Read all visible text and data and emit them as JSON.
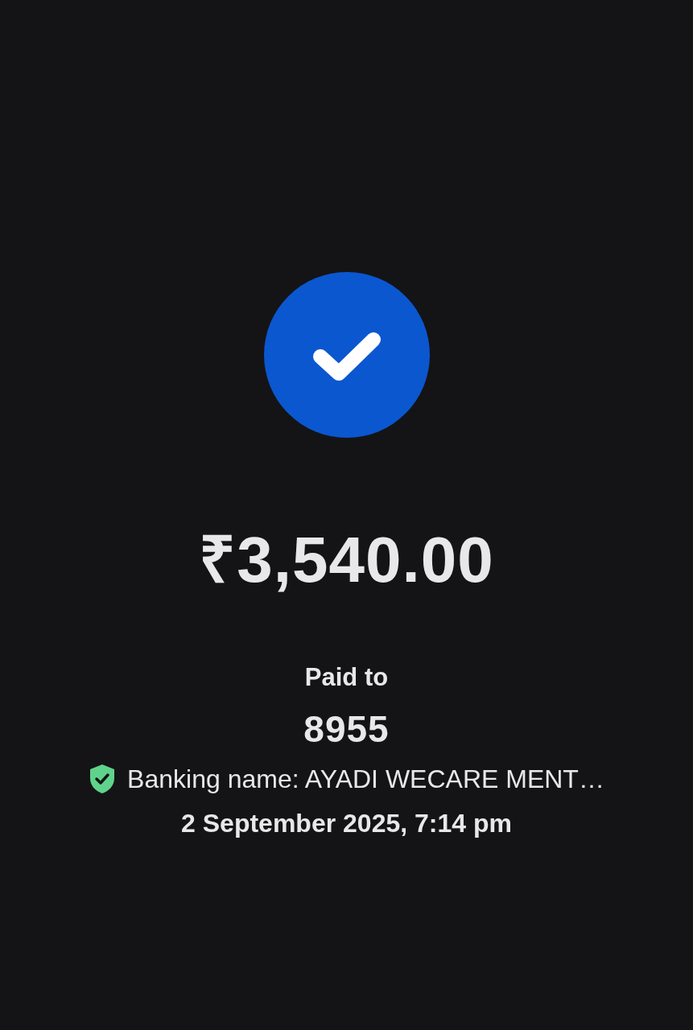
{
  "amount": "₹3,540.00",
  "paid_label": "Paid to",
  "payee": "8955",
  "banking_name": {
    "verified": true,
    "text": "Banking name: AYADI WECARE MENT…"
  },
  "datetime": "2 September 2025, 7:14 pm"
}
